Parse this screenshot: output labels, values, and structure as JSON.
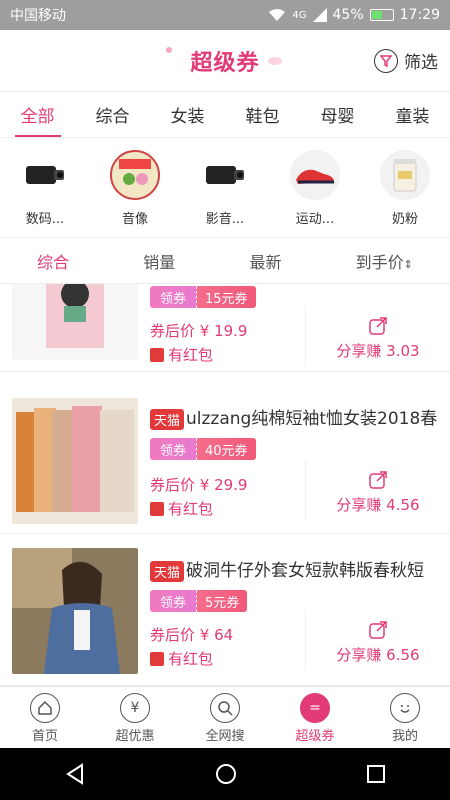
{
  "status": {
    "carrier": "中国移动",
    "battery": "45%",
    "time": "17:29",
    "network": "4G"
  },
  "header": {
    "title": "超级券",
    "filter_label": "筛选"
  },
  "categories": [
    "全部",
    "综合",
    "女装",
    "鞋包",
    "母婴",
    "童装"
  ],
  "icon_items": [
    {
      "label": "数码...",
      "icon": "camcorder-icon"
    },
    {
      "label": "音像",
      "icon": "cartoon-cover-icon"
    },
    {
      "label": "影音...",
      "icon": "camcorder-icon"
    },
    {
      "label": "运动...",
      "icon": "sneaker-icon"
    },
    {
      "label": "奶粉",
      "icon": "milk-can-icon"
    }
  ],
  "sort": [
    "综合",
    "销量",
    "最新",
    "到手价"
  ],
  "products": [
    {
      "title": "",
      "tag": "",
      "coupon_get": "领券",
      "coupon_amount": "15元券",
      "price": "券后价 ¥ 19.9",
      "redpacket": "有红包",
      "share": "分享赚 3.03"
    },
    {
      "title": "ulzzang纯棉短袖t恤女装2018春",
      "tag": "天猫",
      "coupon_get": "领券",
      "coupon_amount": "40元券",
      "price": "券后价 ¥ 29.9",
      "redpacket": "有红包",
      "share": "分享赚 4.56"
    },
    {
      "title": "破洞牛仔外套女短款韩版春秋短",
      "tag": "天猫",
      "coupon_get": "领券",
      "coupon_amount": "5元券",
      "price": "券后价 ¥ 64",
      "redpacket": "有红包",
      "share": "分享赚 6.56"
    }
  ],
  "nav": [
    {
      "label": "首页",
      "icon": "home-icon"
    },
    {
      "label": "超优惠",
      "icon": "yen-icon"
    },
    {
      "label": "全网搜",
      "icon": "search-icon"
    },
    {
      "label": "超级券",
      "icon": "coupon-icon"
    },
    {
      "label": "我的",
      "icon": "smile-icon"
    }
  ],
  "colors": {
    "accent": "#e23a76",
    "tmall": "#e23a3a"
  }
}
